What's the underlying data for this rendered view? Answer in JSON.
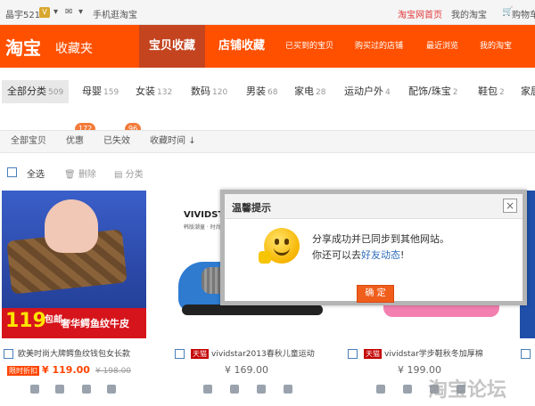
{
  "topbar": {
    "username": "晶宇521",
    "badge": "V",
    "mobile": "手机逛淘宝",
    "home": "淘宝网首页",
    "my_taobao": "我的淘宝",
    "cart": "购物车"
  },
  "header": {
    "logo": "淘宝",
    "title": "收藏夹",
    "tabs": [
      "宝贝收藏",
      "店铺收藏"
    ],
    "links": [
      "已买到的宝贝",
      "购买过的店铺",
      "最近浏览",
      "我的淘宝"
    ]
  },
  "categories": [
    {
      "label": "全部分类",
      "count": "509"
    },
    {
      "label": "母婴",
      "count": "159"
    },
    {
      "label": "女装",
      "count": "132"
    },
    {
      "label": "数码",
      "count": "120"
    },
    {
      "label": "男装",
      "count": "68"
    },
    {
      "label": "家电",
      "count": "28"
    },
    {
      "label": "运动户外",
      "count": "4"
    },
    {
      "label": "配饰/珠宝",
      "count": "2"
    },
    {
      "label": "鞋包",
      "count": "2"
    },
    {
      "label": "家居",
      "count": ""
    }
  ],
  "subtabs": {
    "all": "全部宝贝",
    "discount": "优惠",
    "discount_count": "172",
    "expired": "已失效",
    "expired_count": "96",
    "time": "收藏时间"
  },
  "toolbar": {
    "select_all": "全选",
    "delete": "删除",
    "category": "分类"
  },
  "products": [
    {
      "title": "欧美时尚大牌鳄鱼纹钱包女长款",
      "promo_price": "119",
      "promo_unit": "包邮",
      "promo_slogan": "奢华鳄鱼纹牛皮",
      "tag": "限时折扣",
      "price": "¥ 119.00",
      "old_price": "¥ 198.00"
    },
    {
      "brand": "VIVIDSTAR",
      "brand_sub": "韩版潮童 · 时尚女童鞋",
      "tag": "天猫",
      "title": "vividstar2013春秋儿童运动",
      "price": "¥ 169.00"
    },
    {
      "tag": "天猫",
      "title": "vividstar学步鞋秋冬加厚棉",
      "price": "¥ 199.00"
    }
  ],
  "dialog": {
    "title": "温馨提示",
    "close": "×",
    "line1": "分享成功并已同步到其他网站。",
    "line2_prefix": "你还可以去",
    "line2_link": "好友动态",
    "line2_suffix": "!",
    "ok": "确 定"
  },
  "watermark": "淘宝论坛"
}
